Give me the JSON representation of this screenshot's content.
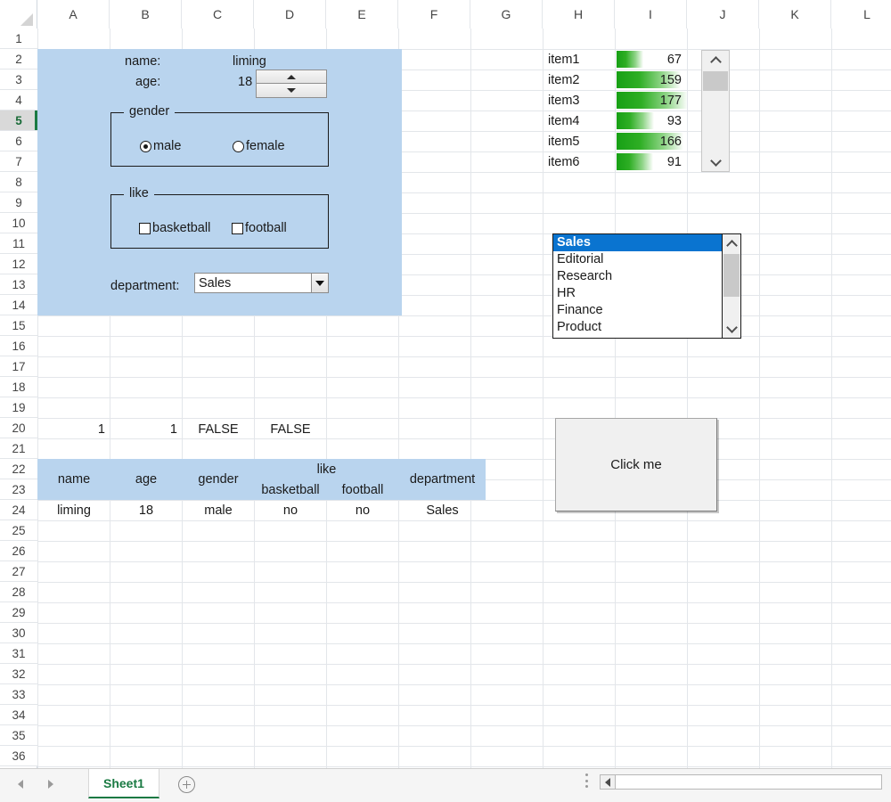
{
  "grid": {
    "columns": [
      "A",
      "B",
      "C",
      "D",
      "E",
      "F",
      "G",
      "H",
      "I",
      "J",
      "K",
      "L"
    ],
    "rows": [
      "1",
      "2",
      "3",
      "4",
      "5",
      "6",
      "7",
      "8",
      "9",
      "10",
      "11",
      "12",
      "13",
      "14",
      "15",
      "16",
      "17",
      "18",
      "19",
      "20",
      "21",
      "22",
      "23",
      "24",
      "25",
      "26",
      "27",
      "28",
      "29",
      "30",
      "31",
      "32",
      "33",
      "34",
      "35",
      "36"
    ],
    "active_row": "5"
  },
  "form": {
    "name_label": "name:",
    "name_value": "liming",
    "age_label": "age:",
    "age_value": "18",
    "gender_group_title": "gender",
    "gender_male": "male",
    "gender_female": "female",
    "like_group_title": "like",
    "like_basketball": "basketball",
    "like_football": "football",
    "department_label": "department:",
    "department_value": "Sales"
  },
  "databars": {
    "items": [
      {
        "label": "item1",
        "value": "67",
        "pct": 38
      },
      {
        "label": "item2",
        "value": "159",
        "pct": 90
      },
      {
        "label": "item3",
        "value": "177",
        "pct": 100
      },
      {
        "label": "item4",
        "value": "93",
        "pct": 53
      },
      {
        "label": "item5",
        "value": "166",
        "pct": 94
      },
      {
        "label": "item6",
        "value": "91",
        "pct": 51
      }
    ]
  },
  "listbox": {
    "options": [
      "Sales",
      "Editorial",
      "Research",
      "HR",
      "Finance",
      "Product"
    ],
    "selected": "Sales"
  },
  "button": {
    "label": "Click me"
  },
  "helper_row": {
    "a": "1",
    "b": "1",
    "c": "FALSE",
    "d": "FALSE"
  },
  "table": {
    "headers": {
      "name": "name",
      "age": "age",
      "gender": "gender",
      "like": "like",
      "basketball": "basketball",
      "football": "football",
      "department": "department"
    },
    "row": {
      "name": "liming",
      "age": "18",
      "gender": "male",
      "basketball": "no",
      "football": "no",
      "department": "Sales"
    }
  },
  "tabbar": {
    "sheet_name": "Sheet1"
  },
  "colors": {
    "panel_blue": "#b9d4ee",
    "databar_green": "#17a015",
    "selection_blue": "#0a74d0",
    "tab_green": "#1a7a43"
  }
}
